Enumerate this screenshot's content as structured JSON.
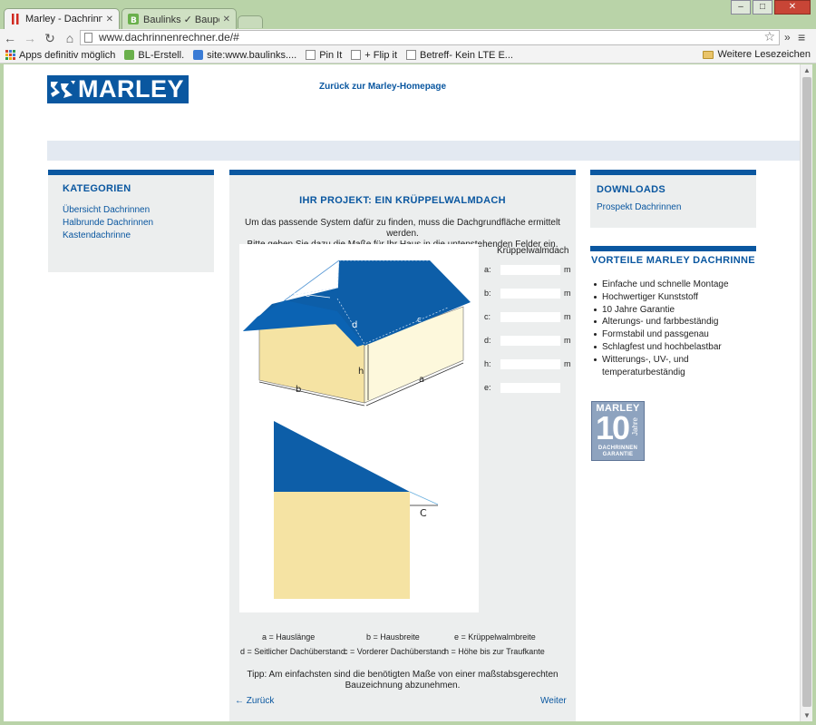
{
  "browser": {
    "tabs": [
      {
        "title": "Marley - Dachrinnenrec",
        "active": true
      },
      {
        "title": "Baulinks ✓ Bauportal fü",
        "active": false
      }
    ],
    "url": "www.dachrinnenrechner.de/#",
    "bookmarks": [
      "Apps definitiv möglich",
      "BL-Erstell.",
      "site:www.baulinks....",
      "Pin It",
      "+ Flip it",
      "Betreff- Kein LTE E..."
    ],
    "bookmarks_right": "Weitere Lesezeichen"
  },
  "header": {
    "logo_text": "MARLEY",
    "back_link": "Zurück zur Marley-Homepage"
  },
  "sidebar_left": {
    "title": "KATEGORIEN",
    "items": [
      "Übersicht Dachrinnen",
      "Halbrunde Dachrinnen",
      "Kastendachrinne"
    ]
  },
  "main": {
    "title": "IHR PROJEKT: EIN KRÜPPELWALMDACH",
    "intro_line1": "Um das passende System dafür zu finden, muss die Dachgrundfläche ermittelt werden.",
    "intro_line2": "Bitte geben Sie dazu die Maße für Ihr Haus in die untenstehenden Felder ein.",
    "form_title": "Krüppelwalmdach",
    "fields": [
      {
        "label": "a:",
        "value": "",
        "unit": "m"
      },
      {
        "label": "b:",
        "value": "",
        "unit": "m"
      },
      {
        "label": "c:",
        "value": "",
        "unit": "m"
      },
      {
        "label": "d:",
        "value": "",
        "unit": "m"
      },
      {
        "label": "h:",
        "value": "",
        "unit": "m"
      },
      {
        "label": "e:",
        "value": "",
        "unit": ""
      }
    ],
    "diagram_labels": {
      "a": "a",
      "b": "b",
      "h": "h",
      "d": "d",
      "e": "e",
      "c_small": "c",
      "c_big": "C"
    },
    "legend": {
      "a": "a = Hauslänge",
      "b": "b = Hausbreite",
      "e": "e = Krüppelwalmbreite",
      "d": "d = Seitlicher Dachüberstand",
      "c": "c = Vorderer Dachüberstand",
      "h": "h = Höhe bis zur Traufkante"
    },
    "tip_line1": "Tipp: Am einfachsten sind die benötigten Maße von einer maßstabsgerechten",
    "tip_line2": "Bauzeichnung abzunehmen.",
    "prev_label": "← Zurück",
    "next_label": "Weiter"
  },
  "sidebar_right": {
    "downloads_title": "DOWNLOADS",
    "downloads": [
      "Prospekt Dachrinnen"
    ],
    "advantages_title": "VORTEILE MARLEY DACHRINNE",
    "advantages": [
      "Einfache und schnelle Montage",
      "Hochwertiger Kunststoff",
      "10 Jahre Garantie",
      "Alterungs- und farbbeständig",
      "Formstabil und passgenau",
      "Schlagfest und hochbelastbar",
      "Witterungs-, UV-, und temperaturbeständig"
    ],
    "badge": {
      "brand": "MARLEY",
      "number": "10",
      "unit": "Jahre",
      "line1": "DACHRINNEN",
      "line2": "GARANTIE"
    }
  },
  "colors": {
    "brand_blue": "#0a57a0",
    "roof_blue": "#0d5ea8",
    "wall_beige": "#f5e3a3",
    "panel_grey": "#eceeee"
  }
}
